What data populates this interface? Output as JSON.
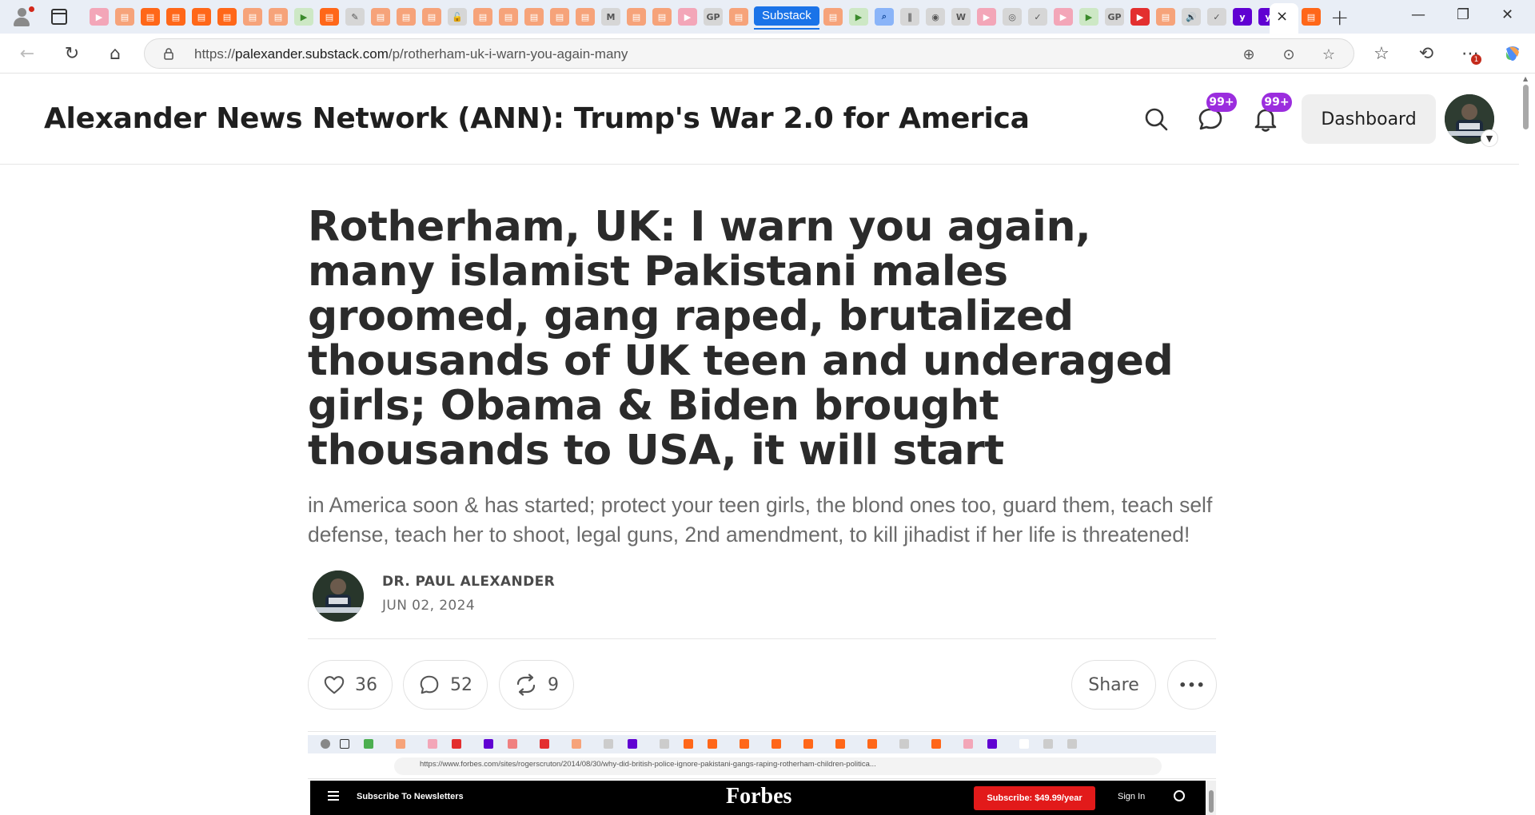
{
  "browser": {
    "substack_tab_label": "Substack",
    "active_tab_close": "×",
    "new_tab": "+",
    "window_controls": {
      "minimize": "—",
      "maximize": "❐",
      "close": "✕"
    },
    "url_host": "palexander.substack.com",
    "url_scheme": "https://",
    "url_path": "/p/rotherham-uk-i-warn-you-again-many",
    "menu_notification_count": "1"
  },
  "site": {
    "title": "Alexander News Network (ANN): Trump's War 2.0 for America",
    "chat_badge": "99+",
    "notifications_badge": "99+",
    "dashboard_label": "Dashboard"
  },
  "post": {
    "title": "Rotherham, UK: I warn you again, many islamist Pakistani males groomed, gang raped, brutalized thousands of UK teen and underaged girls; Obama & Biden brought thousands to USA, it will start",
    "subtitle": "in America soon & has started; protect your teen girls, the blond ones too, guard them, teach self defense, teach her to shoot, legal guns, 2nd amendment, to kill jihadist if her life is threatened!",
    "author": "DR. PAUL ALEXANDER",
    "date": "JUN 02, 2024",
    "likes": "36",
    "comments": "52",
    "restacks": "9",
    "share_label": "Share",
    "more_label": "•••"
  },
  "embedded_screenshot": {
    "url": "https://www.forbes.com/sites/rogerscruton/2014/08/30/why-did-british-police-ignore-pakistani-gangs-raping-rotherham-children-politica...",
    "newsletter_label": "Subscribe To Newsletters",
    "logo": "Forbes",
    "subscribe_label": "Subscribe: $49.99/year",
    "signin_label": "Sign In"
  },
  "colors": {
    "accent_substack": "#ff6719",
    "badge_purple": "#9b2dde",
    "forbes_red": "#e21a1a"
  }
}
